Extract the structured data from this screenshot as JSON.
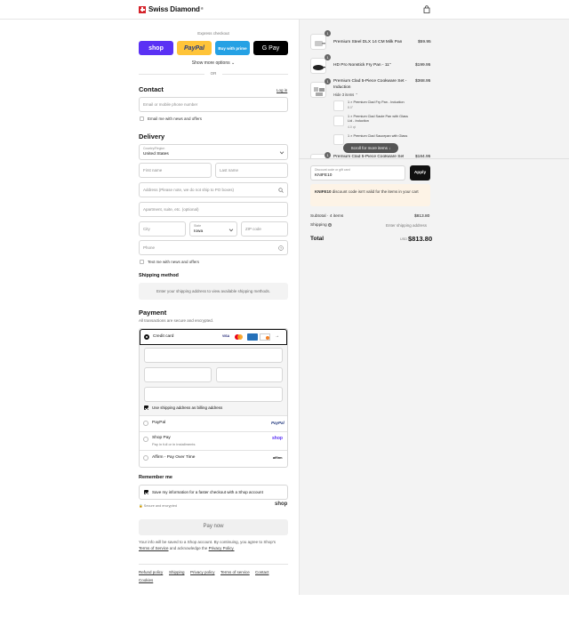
{
  "brand": {
    "name": "Swiss Diamond",
    "mark": "®"
  },
  "express": {
    "title": "Express checkout",
    "buttons": [
      "shop",
      "PayPal",
      "Buy with prime",
      "G Pay"
    ],
    "more": "Show more options",
    "or": "OR"
  },
  "contact": {
    "title": "Contact",
    "login": "Log in",
    "email_placeholder": "Email or mobile phone number",
    "news_label": "Email me with news and offers"
  },
  "delivery": {
    "title": "Delivery",
    "country_label": "Country/Region",
    "country_value": "United States",
    "first_name": "First name",
    "last_name": "Last name",
    "address": "Address (Please note, we do not ship to PO boxes)",
    "apartment": "Apartment, suite, etc. (optional)",
    "city": "City",
    "state_label": "State",
    "state_value": "Iowa",
    "zip": "ZIP code",
    "phone": "Phone",
    "text_label": "Text me with news and offers"
  },
  "shipping": {
    "title": "Shipping method",
    "message": "Enter your shipping address to view available shipping methods."
  },
  "payment": {
    "title": "Payment",
    "subtitle": "All transactions are secure and encrypted.",
    "credit_card": "Credit card",
    "card_brands": [
      "VISA",
      "MC",
      "AMEX",
      "DISCOVER"
    ],
    "billing_label": "Use shipping address as billing address",
    "paypal": "PayPal",
    "shop_pay": "Shop Pay",
    "shop_pay_sub": "Pay in full or in installments",
    "affirm": "Affirm - Pay Over Time",
    "paypal_logo": "PayPal",
    "shop_logo": "shop",
    "affirm_logo": "affirm"
  },
  "remember": {
    "title": "Remember me",
    "save_label": "Save my information for a faster checkout with a Shop account",
    "secure": "Secure and encrypted",
    "shop": "shop"
  },
  "pay_now": "Pay now",
  "legal": {
    "line1": "Your info will be saved to a Shop account. By continuing, you agree to Shop's",
    "terms": "Terms of Service",
    "and": "and acknowledge the",
    "privacy": "Privacy Policy."
  },
  "footer_links": [
    "Refund policy",
    "Shipping",
    "Privacy policy",
    "Terms of service",
    "Contact",
    "Cookies"
  ],
  "cart": {
    "items": [
      {
        "qty": "1",
        "name": "Premium Steel DLX 14 CM Milk Pan",
        "price": "$59.95"
      },
      {
        "qty": "1",
        "name": "HD Pro Nonstick Fry Pan - 11\"",
        "price": "$199.95"
      },
      {
        "qty": "1",
        "name": "Premium Clad 5-Piece Cookware Set - Induction",
        "price": "$368.95",
        "toggle": "Hide 3 items"
      }
    ],
    "sub_items": [
      {
        "name": "1 × Premium Clad Fry Pan - Induction",
        "sub": "8.0\""
      },
      {
        "name": "1 × Premium Clad Saute Pan with Glass Lid - Induction",
        "sub": "4.0 qt"
      },
      {
        "name": "1 × Premium Clad Saucepan with Glass",
        "sub": ""
      }
    ],
    "hidden_item": {
      "name": "Premium Clad 5-Piece Cookware Set",
      "price": "$184.95"
    },
    "scroll_hint": "Scroll for more items",
    "discount_label": "Discount code or gift card",
    "discount_value": "KNIFE10",
    "apply": "Apply",
    "error_code": "KNIFE10",
    "error_text": "discount code isn't valid for the items in your cart",
    "subtotal_label": "Subtotal · 4 items",
    "subtotal_value": "$813.80",
    "shipping_label": "Shipping",
    "shipping_value": "Enter shipping address",
    "total_label": "Total",
    "currency": "USD",
    "total_value": "$813.80"
  },
  "colors": {
    "shop": "#5a31f4",
    "paypal": "#ffc439",
    "amazon": "#25a1e4",
    "gpay": "#000000",
    "error_bg": "#fdf3e6"
  }
}
